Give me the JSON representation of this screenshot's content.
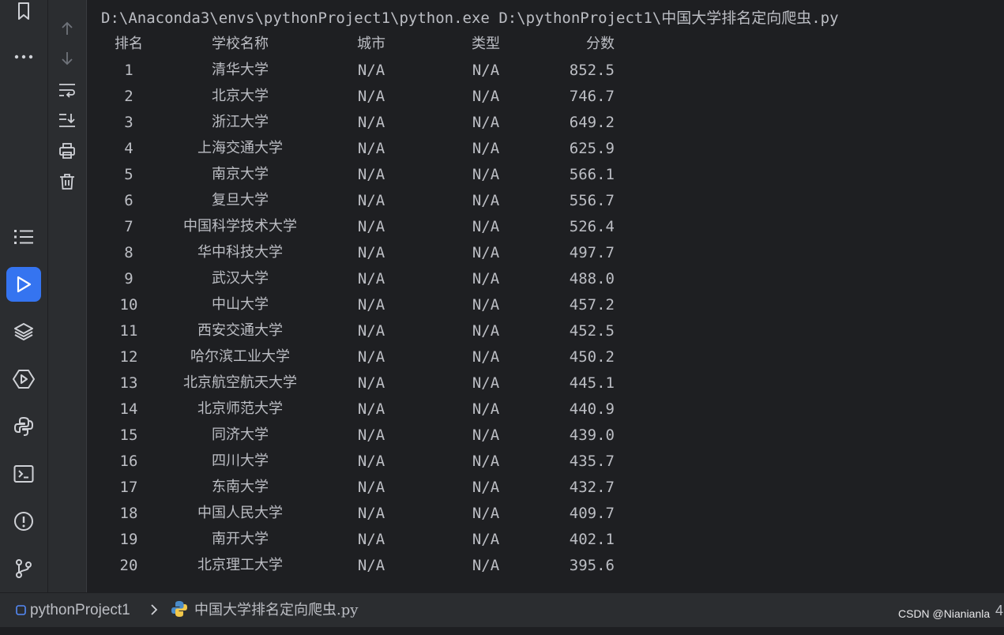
{
  "console": {
    "command_line": "D:\\Anaconda3\\envs\\pythonProject1\\python.exe D:\\pythonProject1\\中国大学排名定向爬虫.py",
    "headers": {
      "rank": "排名",
      "name": "学校名称",
      "city": "城市",
      "type": "类型",
      "score": "分数"
    },
    "rows": [
      {
        "rank": "1",
        "name": "清华大学",
        "city": "N/A",
        "type": "N/A",
        "score": "852.5"
      },
      {
        "rank": "2",
        "name": "北京大学",
        "city": "N/A",
        "type": "N/A",
        "score": "746.7"
      },
      {
        "rank": "3",
        "name": "浙江大学",
        "city": "N/A",
        "type": "N/A",
        "score": "649.2"
      },
      {
        "rank": "4",
        "name": "上海交通大学",
        "city": "N/A",
        "type": "N/A",
        "score": "625.9"
      },
      {
        "rank": "5",
        "name": "南京大学",
        "city": "N/A",
        "type": "N/A",
        "score": "566.1"
      },
      {
        "rank": "6",
        "name": "复旦大学",
        "city": "N/A",
        "type": "N/A",
        "score": "556.7"
      },
      {
        "rank": "7",
        "name": "中国科学技术大学",
        "city": "N/A",
        "type": "N/A",
        "score": "526.4"
      },
      {
        "rank": "8",
        "name": "华中科技大学",
        "city": "N/A",
        "type": "N/A",
        "score": "497.7"
      },
      {
        "rank": "9",
        "name": "武汉大学",
        "city": "N/A",
        "type": "N/A",
        "score": "488.0"
      },
      {
        "rank": "10",
        "name": "中山大学",
        "city": "N/A",
        "type": "N/A",
        "score": "457.2"
      },
      {
        "rank": "11",
        "name": "西安交通大学",
        "city": "N/A",
        "type": "N/A",
        "score": "452.5"
      },
      {
        "rank": "12",
        "name": "哈尔滨工业大学",
        "city": "N/A",
        "type": "N/A",
        "score": "450.2"
      },
      {
        "rank": "13",
        "name": "北京航空航天大学",
        "city": "N/A",
        "type": "N/A",
        "score": "445.1"
      },
      {
        "rank": "14",
        "name": "北京师范大学",
        "city": "N/A",
        "type": "N/A",
        "score": "440.9"
      },
      {
        "rank": "15",
        "name": "同济大学",
        "city": "N/A",
        "type": "N/A",
        "score": "439.0"
      },
      {
        "rank": "16",
        "name": "四川大学",
        "city": "N/A",
        "type": "N/A",
        "score": "435.7"
      },
      {
        "rank": "17",
        "name": "东南大学",
        "city": "N/A",
        "type": "N/A",
        "score": "432.7"
      },
      {
        "rank": "18",
        "name": "中国人民大学",
        "city": "N/A",
        "type": "N/A",
        "score": "409.7"
      },
      {
        "rank": "19",
        "name": "南开大学",
        "city": "N/A",
        "type": "N/A",
        "score": "402.1"
      },
      {
        "rank": "20",
        "name": "北京理工大学",
        "city": "N/A",
        "type": "N/A",
        "score": "395.6"
      }
    ]
  },
  "statusbar": {
    "project": "pythonProject1",
    "file": "中国大学排名定向爬虫.py",
    "right_number": "4",
    "watermark": "CSDN @Nianianla"
  },
  "left_strip_icons": [
    "bookmark-icon",
    "more-icon",
    "structure-icon",
    "run-icon",
    "layers-icon",
    "services-icon",
    "python-console-icon",
    "terminal-icon",
    "problems-icon",
    "git-icon"
  ],
  "toolbar_icons": [
    "scroll-up-icon",
    "scroll-down-icon",
    "soft-wrap-icon",
    "scroll-to-end-icon",
    "print-icon",
    "clear-all-icon"
  ],
  "colors": {
    "active_tool": "#3574f0",
    "background": "#1e1f22",
    "panel": "#2b2d30",
    "text": "#bcbec4"
  }
}
